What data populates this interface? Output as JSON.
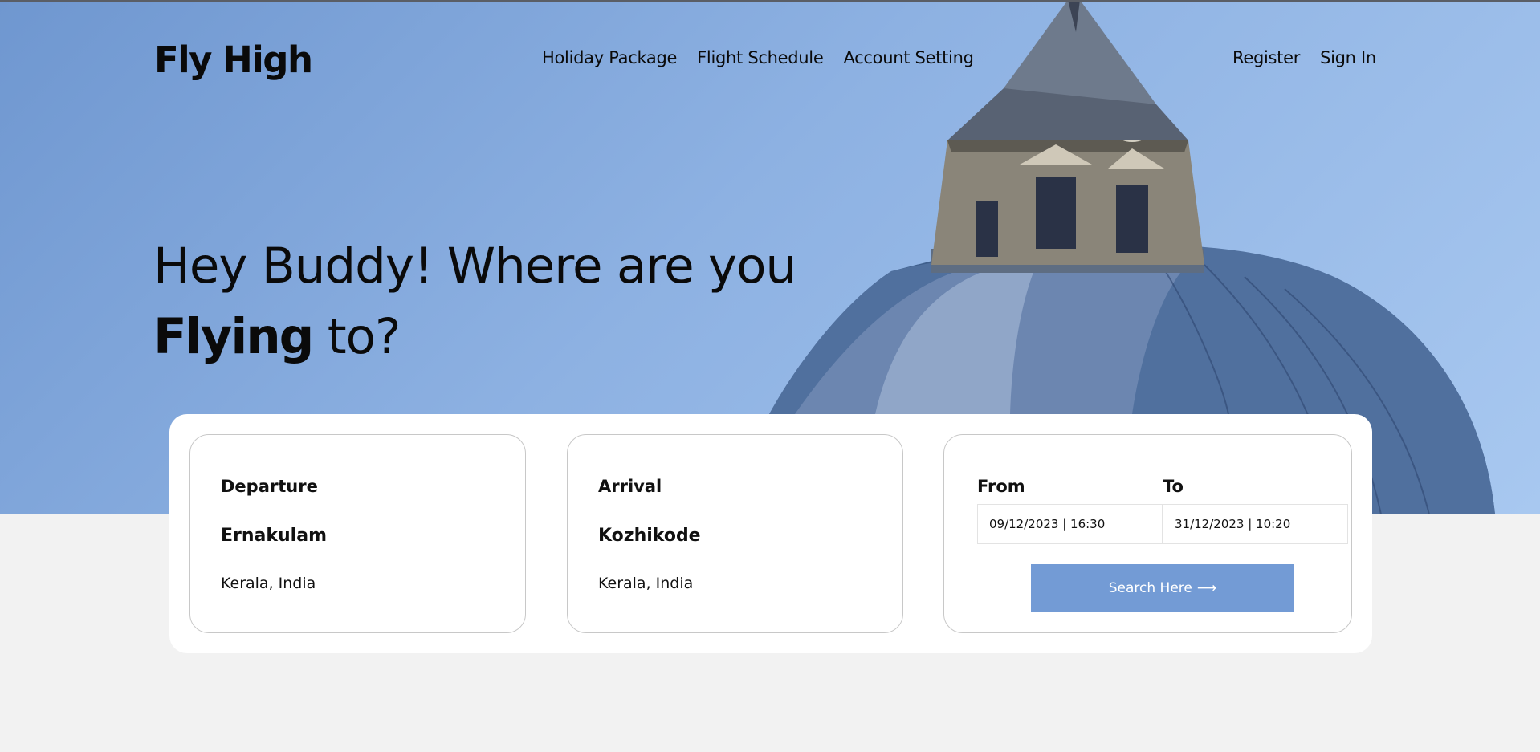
{
  "brand": {
    "name": "Fly High"
  },
  "nav": {
    "main": [
      "Holiday Package",
      "Flight Schedule",
      "Account Setting"
    ],
    "auth": [
      "Register",
      "Sign In"
    ]
  },
  "hero": {
    "line1": "Hey Buddy! Where are you",
    "line2_bold": "Flying",
    "line2_rest": " to?"
  },
  "search": {
    "departure": {
      "label": "Departure",
      "city": "Ernakulam",
      "region": "Kerala, India"
    },
    "arrival": {
      "label": "Arrival",
      "city": "Kozhikode",
      "region": "Kerala, India"
    },
    "from_label": "From",
    "to_label": "To",
    "from_value": "09/12/2023 | 16:30",
    "to_value": "31/12/2023 | 10:20",
    "button_label": "Search Here",
    "button_icon": "arrow-right-icon"
  },
  "colors": {
    "hero_sky": "#8db1e2",
    "button": "#739bd5",
    "page_bg": "#f2f2f2"
  }
}
